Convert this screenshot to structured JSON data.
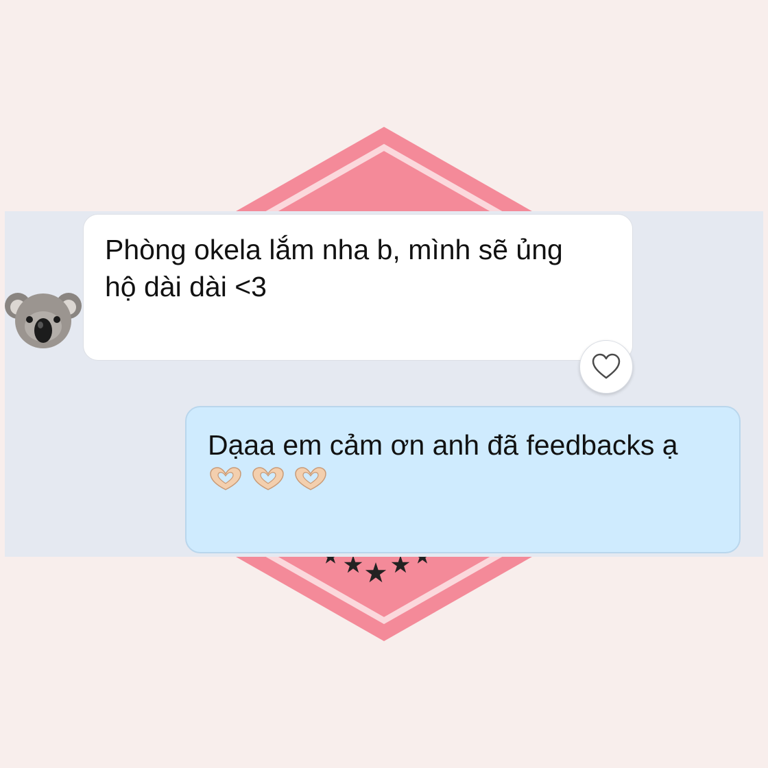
{
  "chat": {
    "incoming": {
      "text": "Phòng okela lắm nha b, mình sẽ ủng\nhộ dài dài <3",
      "avatar_icon": "koala-emoji",
      "reaction_icon": "heart-outline-icon"
    },
    "outgoing": {
      "text": "Dạaa em cảm ơn anh đã feedbacks ạ",
      "emoji_icons": [
        "heart-hands-emoji",
        "heart-hands-emoji",
        "heart-hands-emoji"
      ]
    }
  },
  "colors": {
    "page_background": "#f8eeec",
    "badge_pink": "#f48a99",
    "chat_background": "#e5e9f1",
    "incoming_bubble": "#ffffff",
    "outgoing_bubble": "#cfebfe",
    "stars": "#222222"
  }
}
